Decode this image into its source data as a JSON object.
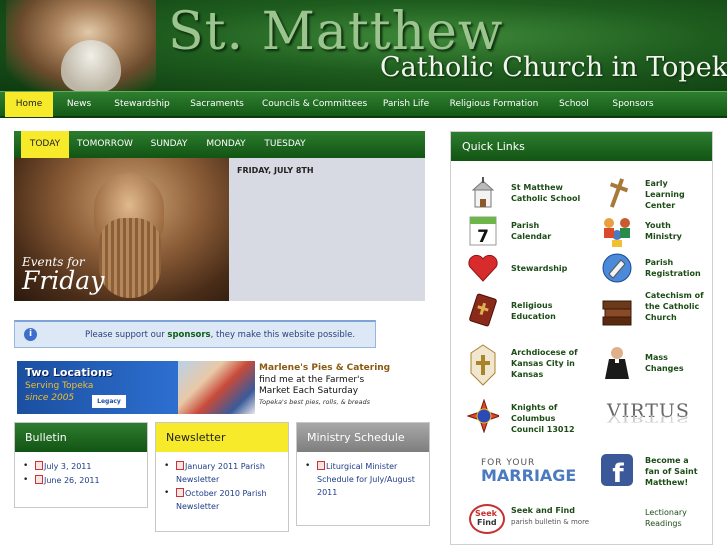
{
  "header": {
    "title_line1": "St. Matthew",
    "title_line2": "Catholic Church in Topeka"
  },
  "nav": {
    "items": [
      "Home",
      "News",
      "Stewardship",
      "Sacraments",
      "Councils & Committees",
      "Parish Life",
      "Religious Formation",
      "School",
      "Sponsors"
    ],
    "active": "Home"
  },
  "events": {
    "tabs": [
      "TODAY",
      "TOMORROW",
      "SUNDAY",
      "MONDAY",
      "TUESDAY"
    ],
    "active_tab": "TODAY",
    "image_small": "Events for",
    "image_big": "Friday",
    "date": "FRIDAY, JULY 8TH"
  },
  "support": {
    "before": "Please support our ",
    "link": "sponsors",
    "after": ", they make this website possible."
  },
  "ad": {
    "left_title": "Two Locations",
    "left_line2": "Serving Topeka",
    "left_line3": "since 2005",
    "left_logo": "Legacy",
    "right_title": "Marlene's Pies & Catering",
    "right_line2": "find me at the Farmer's",
    "right_line3": "Market Each Saturday",
    "right_line4": "Topeka's best pies, rolls, & breads"
  },
  "bulletin": {
    "title": "Bulletin",
    "items": [
      "July 3, 2011",
      "June 26, 2011"
    ]
  },
  "newsletter": {
    "title": "Newsletter",
    "items": [
      "January 2011 Parish Newsletter",
      "October 2010 Parish Newsletter"
    ]
  },
  "ministry": {
    "title": "Ministry Schedule",
    "items": [
      "Liturgical Minister Schedule for July/August 2011"
    ]
  },
  "quick_links": {
    "title": "Quick Links",
    "left": [
      {
        "label": "St Matthew Catholic School",
        "icon": "school-icon"
      },
      {
        "label": "Parish Calendar",
        "icon": "calendar-icon"
      },
      {
        "label": "Stewardship",
        "icon": "heart-icon"
      },
      {
        "label": "Religious Education",
        "icon": "bible-icon"
      },
      {
        "label": "Archdiocese of Kansas City in Kansas",
        "icon": "crest-icon"
      },
      {
        "label": "Knights of Columbus Council 13012",
        "icon": "knights-icon"
      },
      {
        "label": "",
        "icon": "for-your-marriage-logo"
      },
      {
        "label": "Seek and Find",
        "sub": "parish bulletin & more",
        "icon": "seek-find-icon"
      }
    ],
    "right": [
      {
        "label": "Early Learning Center",
        "icon": "cross-icon"
      },
      {
        "label": "Youth Ministry",
        "icon": "people-icon"
      },
      {
        "label": "Parish Registration",
        "icon": "pen-icon"
      },
      {
        "label": "Catechism of the Catholic Church",
        "icon": "books-icon"
      },
      {
        "label": "Mass Changes",
        "icon": "priest-icon"
      },
      {
        "label": "",
        "icon": "virtus-logo"
      },
      {
        "label": "Become a fan of Saint Matthew!",
        "icon": "facebook-icon"
      },
      {
        "label": "Lectionary Readings",
        "icon": "none"
      }
    ],
    "logo_text": {
      "for_your": "FOR YOUR",
      "marriage": "MARRIAGE",
      "virtus": "VIRTUS",
      "seek": "Seek",
      "find": "Find",
      "calendar_day": "7"
    }
  },
  "colors": {
    "accent_yellow": "#f7ea2a",
    "green_dark": "#125414",
    "green_mid": "#2d7d2f",
    "link_green": "#1d4d17"
  }
}
